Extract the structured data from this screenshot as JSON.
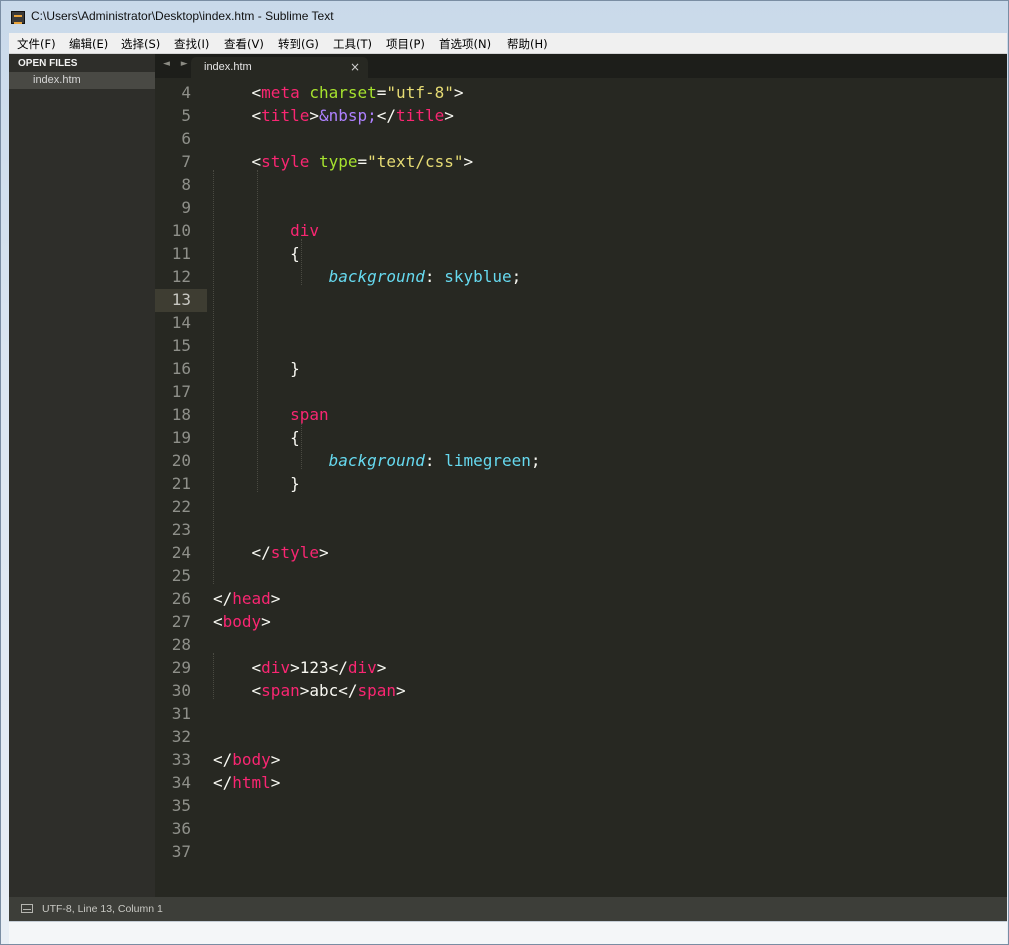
{
  "window": {
    "title": "C:\\Users\\Administrator\\Desktop\\index.htm - Sublime Text"
  },
  "menu": [
    {
      "label": "文件(F)"
    },
    {
      "label": "编辑(E)"
    },
    {
      "label": "选择(S)"
    },
    {
      "label": "查找(I)"
    },
    {
      "label": "查看(V)"
    },
    {
      "label": "转到(G)"
    },
    {
      "label": "工具(T)"
    },
    {
      "label": "项目(P)"
    },
    {
      "label": "首选项(N)"
    },
    {
      "label": "帮助(H)"
    }
  ],
  "sidebar": {
    "header": "OPEN FILES",
    "files": [
      {
        "name": "index.htm"
      }
    ]
  },
  "tabs": [
    {
      "label": "index.htm",
      "close": "×"
    }
  ],
  "nav": {
    "arrows": "◄ ►"
  },
  "editor": {
    "current_line": 13,
    "lines": [
      {
        "num": 4,
        "tokens": [
          {
            "t": "    ",
            "c": "tk-text"
          },
          {
            "t": "<",
            "c": "tk-punct"
          },
          {
            "t": "meta",
            "c": "tk-tag"
          },
          {
            "t": " ",
            "c": "tk-text"
          },
          {
            "t": "charset",
            "c": "tk-attr"
          },
          {
            "t": "=",
            "c": "tk-punct"
          },
          {
            "t": "\"utf-8\"",
            "c": "tk-str"
          },
          {
            "t": ">",
            "c": "tk-punct"
          }
        ]
      },
      {
        "num": 5,
        "tokens": [
          {
            "t": "    ",
            "c": "tk-text"
          },
          {
            "t": "<",
            "c": "tk-punct"
          },
          {
            "t": "title",
            "c": "tk-tag"
          },
          {
            "t": ">",
            "c": "tk-punct"
          },
          {
            "t": "&nbsp;",
            "c": "tk-ent"
          },
          {
            "t": "</",
            "c": "tk-punct"
          },
          {
            "t": "title",
            "c": "tk-tag"
          },
          {
            "t": ">",
            "c": "tk-punct"
          }
        ]
      },
      {
        "num": 6,
        "tokens": []
      },
      {
        "num": 7,
        "tokens": [
          {
            "t": "    ",
            "c": "tk-text"
          },
          {
            "t": "<",
            "c": "tk-punct"
          },
          {
            "t": "style",
            "c": "tk-tag"
          },
          {
            "t": " ",
            "c": "tk-text"
          },
          {
            "t": "type",
            "c": "tk-attr"
          },
          {
            "t": "=",
            "c": "tk-punct"
          },
          {
            "t": "\"text/css\"",
            "c": "tk-str"
          },
          {
            "t": ">",
            "c": "tk-punct"
          }
        ]
      },
      {
        "num": 8,
        "tokens": []
      },
      {
        "num": 9,
        "tokens": []
      },
      {
        "num": 10,
        "tokens": [
          {
            "t": "        ",
            "c": "tk-text"
          },
          {
            "t": "div",
            "c": "tk-tag"
          }
        ]
      },
      {
        "num": 11,
        "tokens": [
          {
            "t": "        ",
            "c": "tk-text"
          },
          {
            "t": "{",
            "c": "tk-punct"
          }
        ]
      },
      {
        "num": 12,
        "tokens": [
          {
            "t": "            ",
            "c": "tk-text"
          },
          {
            "t": "background",
            "c": "tk-prop"
          },
          {
            "t": ": ",
            "c": "tk-punct"
          },
          {
            "t": "skyblue",
            "c": "tk-val"
          },
          {
            "t": ";",
            "c": "tk-punct"
          }
        ]
      },
      {
        "num": 13,
        "tokens": []
      },
      {
        "num": 14,
        "tokens": []
      },
      {
        "num": 15,
        "tokens": []
      },
      {
        "num": 16,
        "tokens": [
          {
            "t": "        ",
            "c": "tk-text"
          },
          {
            "t": "}",
            "c": "tk-punct"
          }
        ]
      },
      {
        "num": 17,
        "tokens": []
      },
      {
        "num": 18,
        "tokens": [
          {
            "t": "        ",
            "c": "tk-text"
          },
          {
            "t": "span",
            "c": "tk-tag"
          }
        ]
      },
      {
        "num": 19,
        "tokens": [
          {
            "t": "        ",
            "c": "tk-text"
          },
          {
            "t": "{",
            "c": "tk-punct"
          }
        ]
      },
      {
        "num": 20,
        "tokens": [
          {
            "t": "            ",
            "c": "tk-text"
          },
          {
            "t": "background",
            "c": "tk-prop"
          },
          {
            "t": ": ",
            "c": "tk-punct"
          },
          {
            "t": "limegreen",
            "c": "tk-val"
          },
          {
            "t": ";",
            "c": "tk-punct"
          }
        ]
      },
      {
        "num": 21,
        "tokens": [
          {
            "t": "        ",
            "c": "tk-text"
          },
          {
            "t": "}",
            "c": "tk-punct"
          }
        ]
      },
      {
        "num": 22,
        "tokens": []
      },
      {
        "num": 23,
        "tokens": []
      },
      {
        "num": 24,
        "tokens": [
          {
            "t": "    ",
            "c": "tk-text"
          },
          {
            "t": "</",
            "c": "tk-punct"
          },
          {
            "t": "style",
            "c": "tk-tag"
          },
          {
            "t": ">",
            "c": "tk-punct"
          }
        ]
      },
      {
        "num": 25,
        "tokens": []
      },
      {
        "num": 26,
        "tokens": [
          {
            "t": "</",
            "c": "tk-punct"
          },
          {
            "t": "head",
            "c": "tk-tag"
          },
          {
            "t": ">",
            "c": "tk-punct"
          }
        ]
      },
      {
        "num": 27,
        "tokens": [
          {
            "t": "<",
            "c": "tk-punct"
          },
          {
            "t": "body",
            "c": "tk-tag"
          },
          {
            "t": ">",
            "c": "tk-punct"
          }
        ]
      },
      {
        "num": 28,
        "tokens": []
      },
      {
        "num": 29,
        "tokens": [
          {
            "t": "    ",
            "c": "tk-text"
          },
          {
            "t": "<",
            "c": "tk-punct"
          },
          {
            "t": "div",
            "c": "tk-tag"
          },
          {
            "t": ">",
            "c": "tk-punct"
          },
          {
            "t": "123",
            "c": "tk-text"
          },
          {
            "t": "</",
            "c": "tk-punct"
          },
          {
            "t": "div",
            "c": "tk-tag"
          },
          {
            "t": ">",
            "c": "tk-punct"
          }
        ]
      },
      {
        "num": 30,
        "tokens": [
          {
            "t": "    ",
            "c": "tk-text"
          },
          {
            "t": "<",
            "c": "tk-punct"
          },
          {
            "t": "span",
            "c": "tk-tag"
          },
          {
            "t": ">",
            "c": "tk-punct"
          },
          {
            "t": "abc",
            "c": "tk-text"
          },
          {
            "t": "</",
            "c": "tk-punct"
          },
          {
            "t": "span",
            "c": "tk-tag"
          },
          {
            "t": ">",
            "c": "tk-punct"
          }
        ]
      },
      {
        "num": 31,
        "tokens": []
      },
      {
        "num": 32,
        "tokens": []
      },
      {
        "num": 33,
        "tokens": [
          {
            "t": "</",
            "c": "tk-punct"
          },
          {
            "t": "body",
            "c": "tk-tag"
          },
          {
            "t": ">",
            "c": "tk-punct"
          }
        ]
      },
      {
        "num": 34,
        "tokens": [
          {
            "t": "</",
            "c": "tk-punct"
          },
          {
            "t": "html",
            "c": "tk-tag"
          },
          {
            "t": ">",
            "c": "tk-punct"
          }
        ]
      },
      {
        "num": 35,
        "tokens": []
      },
      {
        "num": 36,
        "tokens": []
      },
      {
        "num": 37,
        "tokens": []
      }
    ]
  },
  "status": {
    "text": "UTF-8, Line 13, Column 1"
  },
  "colors": {
    "editor_bg": "#272822",
    "tag": "#f92672",
    "attr": "#a6e22e",
    "string": "#e6db74",
    "entity": "#ae81ff",
    "property": "#66d9ef"
  }
}
